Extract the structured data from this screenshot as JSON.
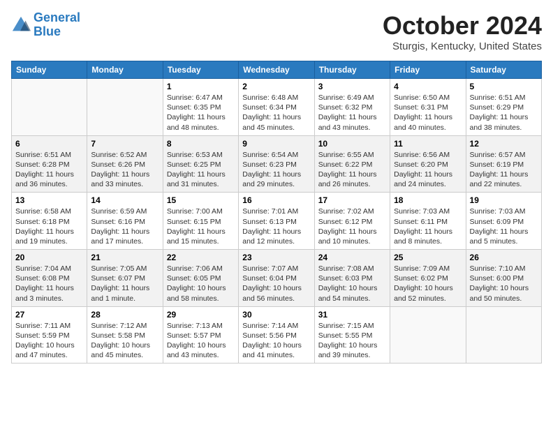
{
  "header": {
    "logo_line1": "General",
    "logo_line2": "Blue",
    "month_title": "October 2024",
    "location": "Sturgis, Kentucky, United States"
  },
  "days_of_week": [
    "Sunday",
    "Monday",
    "Tuesday",
    "Wednesday",
    "Thursday",
    "Friday",
    "Saturday"
  ],
  "weeks": [
    [
      {
        "day": "",
        "info": ""
      },
      {
        "day": "",
        "info": ""
      },
      {
        "day": "1",
        "info": "Sunrise: 6:47 AM\nSunset: 6:35 PM\nDaylight: 11 hours and 48 minutes."
      },
      {
        "day": "2",
        "info": "Sunrise: 6:48 AM\nSunset: 6:34 PM\nDaylight: 11 hours and 45 minutes."
      },
      {
        "day": "3",
        "info": "Sunrise: 6:49 AM\nSunset: 6:32 PM\nDaylight: 11 hours and 43 minutes."
      },
      {
        "day": "4",
        "info": "Sunrise: 6:50 AM\nSunset: 6:31 PM\nDaylight: 11 hours and 40 minutes."
      },
      {
        "day": "5",
        "info": "Sunrise: 6:51 AM\nSunset: 6:29 PM\nDaylight: 11 hours and 38 minutes."
      }
    ],
    [
      {
        "day": "6",
        "info": "Sunrise: 6:51 AM\nSunset: 6:28 PM\nDaylight: 11 hours and 36 minutes."
      },
      {
        "day": "7",
        "info": "Sunrise: 6:52 AM\nSunset: 6:26 PM\nDaylight: 11 hours and 33 minutes."
      },
      {
        "day": "8",
        "info": "Sunrise: 6:53 AM\nSunset: 6:25 PM\nDaylight: 11 hours and 31 minutes."
      },
      {
        "day": "9",
        "info": "Sunrise: 6:54 AM\nSunset: 6:23 PM\nDaylight: 11 hours and 29 minutes."
      },
      {
        "day": "10",
        "info": "Sunrise: 6:55 AM\nSunset: 6:22 PM\nDaylight: 11 hours and 26 minutes."
      },
      {
        "day": "11",
        "info": "Sunrise: 6:56 AM\nSunset: 6:20 PM\nDaylight: 11 hours and 24 minutes."
      },
      {
        "day": "12",
        "info": "Sunrise: 6:57 AM\nSunset: 6:19 PM\nDaylight: 11 hours and 22 minutes."
      }
    ],
    [
      {
        "day": "13",
        "info": "Sunrise: 6:58 AM\nSunset: 6:18 PM\nDaylight: 11 hours and 19 minutes."
      },
      {
        "day": "14",
        "info": "Sunrise: 6:59 AM\nSunset: 6:16 PM\nDaylight: 11 hours and 17 minutes."
      },
      {
        "day": "15",
        "info": "Sunrise: 7:00 AM\nSunset: 6:15 PM\nDaylight: 11 hours and 15 minutes."
      },
      {
        "day": "16",
        "info": "Sunrise: 7:01 AM\nSunset: 6:13 PM\nDaylight: 11 hours and 12 minutes."
      },
      {
        "day": "17",
        "info": "Sunrise: 7:02 AM\nSunset: 6:12 PM\nDaylight: 11 hours and 10 minutes."
      },
      {
        "day": "18",
        "info": "Sunrise: 7:03 AM\nSunset: 6:11 PM\nDaylight: 11 hours and 8 minutes."
      },
      {
        "day": "19",
        "info": "Sunrise: 7:03 AM\nSunset: 6:09 PM\nDaylight: 11 hours and 5 minutes."
      }
    ],
    [
      {
        "day": "20",
        "info": "Sunrise: 7:04 AM\nSunset: 6:08 PM\nDaylight: 11 hours and 3 minutes."
      },
      {
        "day": "21",
        "info": "Sunrise: 7:05 AM\nSunset: 6:07 PM\nDaylight: 11 hours and 1 minute."
      },
      {
        "day": "22",
        "info": "Sunrise: 7:06 AM\nSunset: 6:05 PM\nDaylight: 10 hours and 58 minutes."
      },
      {
        "day": "23",
        "info": "Sunrise: 7:07 AM\nSunset: 6:04 PM\nDaylight: 10 hours and 56 minutes."
      },
      {
        "day": "24",
        "info": "Sunrise: 7:08 AM\nSunset: 6:03 PM\nDaylight: 10 hours and 54 minutes."
      },
      {
        "day": "25",
        "info": "Sunrise: 7:09 AM\nSunset: 6:02 PM\nDaylight: 10 hours and 52 minutes."
      },
      {
        "day": "26",
        "info": "Sunrise: 7:10 AM\nSunset: 6:00 PM\nDaylight: 10 hours and 50 minutes."
      }
    ],
    [
      {
        "day": "27",
        "info": "Sunrise: 7:11 AM\nSunset: 5:59 PM\nDaylight: 10 hours and 47 minutes."
      },
      {
        "day": "28",
        "info": "Sunrise: 7:12 AM\nSunset: 5:58 PM\nDaylight: 10 hours and 45 minutes."
      },
      {
        "day": "29",
        "info": "Sunrise: 7:13 AM\nSunset: 5:57 PM\nDaylight: 10 hours and 43 minutes."
      },
      {
        "day": "30",
        "info": "Sunrise: 7:14 AM\nSunset: 5:56 PM\nDaylight: 10 hours and 41 minutes."
      },
      {
        "day": "31",
        "info": "Sunrise: 7:15 AM\nSunset: 5:55 PM\nDaylight: 10 hours and 39 minutes."
      },
      {
        "day": "",
        "info": ""
      },
      {
        "day": "",
        "info": ""
      }
    ]
  ]
}
